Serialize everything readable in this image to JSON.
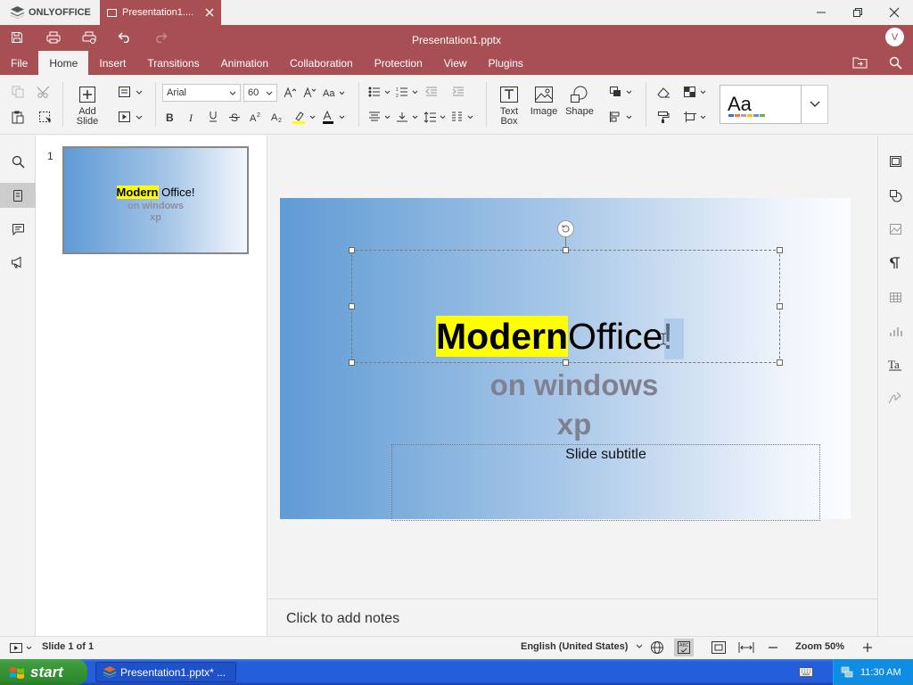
{
  "app": {
    "brand": "ONLYOFFICE",
    "tab_title": "Presentation1....",
    "document_name": "Presentation1.pptx",
    "user_initial": "V"
  },
  "menu": {
    "tabs": [
      "File",
      "Home",
      "Insert",
      "Transitions",
      "Animation",
      "Collaboration",
      "Protection",
      "View",
      "Plugins"
    ],
    "active": "Home"
  },
  "toolbar": {
    "add_slide": "Add Slide",
    "font_name": "Arial",
    "font_size": "60",
    "text_box": "Text Box",
    "image": "Image",
    "shape": "Shape",
    "theme_preview": "Aa"
  },
  "slides_panel": {
    "number": "1",
    "thumb_title_bold": "Modern",
    "thumb_title_rest": " Office!",
    "thumb_line2": "on windows",
    "thumb_line3": "xp"
  },
  "slide": {
    "title_highlight": "Modern",
    "title_rest": " Office!",
    "line2": "on windows",
    "line3": "xp",
    "subtitle": "Slide subtitle"
  },
  "notes": {
    "placeholder": "Click to add notes"
  },
  "status": {
    "slide_info": "Slide 1 of 1",
    "language": "English (United States)",
    "zoom": "Zoom 50%"
  },
  "taskbar": {
    "start_label": "start",
    "window_button": "Presentation1.pptx* ...",
    "clock": "11:30 AM"
  },
  "colors": {
    "brand": "#a84f53",
    "highlight": "#ffff00",
    "taskbar": "#245edb",
    "start": "#3c9b3c"
  }
}
